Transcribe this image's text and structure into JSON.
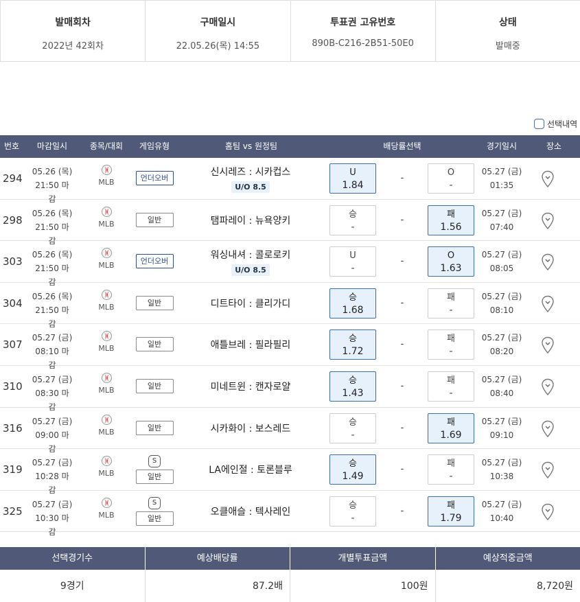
{
  "info": [
    {
      "label": "발매회차",
      "value": "2022년 42회차"
    },
    {
      "label": "구매일시",
      "value": "22.05.26(목) 14:55"
    },
    {
      "label": "투표권 고유번호",
      "value": "890B-C216-2B51-50E0"
    },
    {
      "label": "상태",
      "value": "발매중"
    }
  ],
  "select_label": "선택내역",
  "headers": [
    "번호",
    "마감일시",
    "종목/대회",
    "게임유형",
    "홈팀 vs 원정팀",
    "배당률선택",
    "경기일시",
    "장소"
  ],
  "rows": [
    {
      "no": "294",
      "close_date": "05.26 (목)",
      "close_time": "21:50 마감",
      "sport": "MLB",
      "special": "",
      "type": "언더오버",
      "uo": true,
      "match": "신시레즈 : 시카컵스",
      "line": "U/O 8.5",
      "left_label": "U",
      "left_odds": "1.84",
      "left_sel": true,
      "draw": "-",
      "right_label": "O",
      "right_odds": "-",
      "right_sel": false,
      "game_date": "05.27 (금)",
      "game_time": "01:35"
    },
    {
      "no": "298",
      "close_date": "05.26 (목)",
      "close_time": "21:50 마감",
      "sport": "MLB",
      "special": "",
      "type": "일반",
      "uo": false,
      "match": "탬파레이 : 뉴욕양키",
      "line": "",
      "left_label": "승",
      "left_odds": "-",
      "left_sel": false,
      "draw": "-",
      "right_label": "패",
      "right_odds": "1.56",
      "right_sel": true,
      "game_date": "05.27 (금)",
      "game_time": "07:40"
    },
    {
      "no": "303",
      "close_date": "05.26 (목)",
      "close_time": "21:50 마감",
      "sport": "MLB",
      "special": "",
      "type": "언더오버",
      "uo": true,
      "match": "워싱내셔 : 콜로로키",
      "line": "U/O 8.5",
      "left_label": "U",
      "left_odds": "-",
      "left_sel": false,
      "draw": "-",
      "right_label": "O",
      "right_odds": "1.63",
      "right_sel": true,
      "game_date": "05.27 (금)",
      "game_time": "08:05"
    },
    {
      "no": "304",
      "close_date": "05.26 (목)",
      "close_time": "21:50 마감",
      "sport": "MLB",
      "special": "",
      "type": "일반",
      "uo": false,
      "match": "디트타이 : 클리가디",
      "line": "",
      "left_label": "승",
      "left_odds": "1.68",
      "left_sel": true,
      "draw": "-",
      "right_label": "패",
      "right_odds": "-",
      "right_sel": false,
      "game_date": "05.27 (금)",
      "game_time": "08:10"
    },
    {
      "no": "307",
      "close_date": "05.27 (금)",
      "close_time": "08:10 마감",
      "sport": "MLB",
      "special": "",
      "type": "일반",
      "uo": false,
      "match": "애틀브레 : 필라필리",
      "line": "",
      "left_label": "승",
      "left_odds": "1.72",
      "left_sel": true,
      "draw": "-",
      "right_label": "패",
      "right_odds": "-",
      "right_sel": false,
      "game_date": "05.27 (금)",
      "game_time": "08:20"
    },
    {
      "no": "310",
      "close_date": "05.27 (금)",
      "close_time": "08:30 마감",
      "sport": "MLB",
      "special": "",
      "type": "일반",
      "uo": false,
      "match": "미네트윈 : 캔자로얄",
      "line": "",
      "left_label": "승",
      "left_odds": "1.43",
      "left_sel": true,
      "draw": "-",
      "right_label": "패",
      "right_odds": "-",
      "right_sel": false,
      "game_date": "05.27 (금)",
      "game_time": "08:40"
    },
    {
      "no": "316",
      "close_date": "05.27 (금)",
      "close_time": "09:00 마감",
      "sport": "MLB",
      "special": "",
      "type": "일반",
      "uo": false,
      "match": "시카화이 : 보스레드",
      "line": "",
      "left_label": "승",
      "left_odds": "-",
      "left_sel": false,
      "draw": "-",
      "right_label": "패",
      "right_odds": "1.69",
      "right_sel": true,
      "game_date": "05.27 (금)",
      "game_time": "09:10"
    },
    {
      "no": "319",
      "close_date": "05.27 (금)",
      "close_time": "10:28 마감",
      "sport": "MLB",
      "special": "S",
      "type": "일반",
      "uo": false,
      "match": "LA에인절 : 토론블루",
      "line": "",
      "left_label": "승",
      "left_odds": "1.49",
      "left_sel": true,
      "draw": "-",
      "right_label": "패",
      "right_odds": "-",
      "right_sel": false,
      "game_date": "05.27 (금)",
      "game_time": "10:38"
    },
    {
      "no": "325",
      "close_date": "05.27 (금)",
      "close_time": "10:30 마감",
      "sport": "MLB",
      "special": "S",
      "type": "일반",
      "uo": false,
      "match": "오클애슬 : 텍사레인",
      "line": "",
      "left_label": "승",
      "left_odds": "-",
      "left_sel": false,
      "draw": "-",
      "right_label": "패",
      "right_odds": "1.79",
      "right_sel": true,
      "game_date": "05.27 (금)",
      "game_time": "10:40"
    }
  ],
  "summary": {
    "headers": [
      "선택경기수",
      "예상배당률",
      "개별투표금액",
      "예상적중금액"
    ],
    "values": [
      "9경기",
      "87.2배",
      "100원",
      "8,720원"
    ]
  },
  "colors": {
    "header_bg": "#505a78",
    "selected_bg": "#e7f1fb",
    "selected_border": "#3a6ea5"
  },
  "icons": {
    "sport": "baseball-icon",
    "venue": "map-pin-icon"
  }
}
